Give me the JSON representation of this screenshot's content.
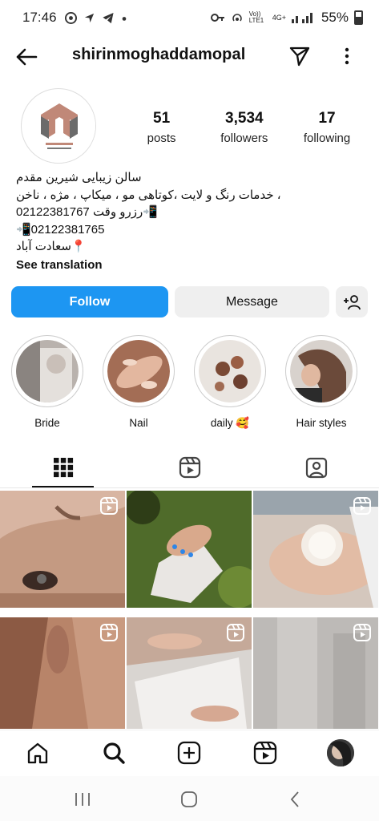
{
  "status_bar": {
    "time": "17:46",
    "network_label": "Vo)) LTE1",
    "network_gen": "4G+",
    "battery": "55%"
  },
  "header": {
    "username": "shirinmoghaddamopal",
    "icons": [
      "back-arrow-icon",
      "send-icon",
      "more-icon"
    ]
  },
  "profile": {
    "stats": [
      {
        "value": "51",
        "label": "posts"
      },
      {
        "value": "3,534",
        "label": "followers"
      },
      {
        "value": "17",
        "label": "following"
      }
    ],
    "bio_lines": [
      "سالن زیبایی شیرین مقدم",
      "، خدمات رنگ و لایت ،کوتاهی مو ، میکاپ ، مژه ، ناخن",
      "02122381767 رزرو وقت📲",
      "📲02122381765",
      "📍سعادت آباد"
    ],
    "see_translation": "See translation"
  },
  "actions": {
    "follow": "Follow",
    "message": "Message"
  },
  "highlights": [
    {
      "label": "Bride"
    },
    {
      "label": "Nail"
    },
    {
      "label": "daily 🥰"
    },
    {
      "label": "Hair styles"
    }
  ],
  "tabs": [
    "grid-icon",
    "reels-icon",
    "tagged-icon"
  ],
  "colors": {
    "follow_blue": "#1d96f2",
    "button_gray": "#efefef"
  }
}
